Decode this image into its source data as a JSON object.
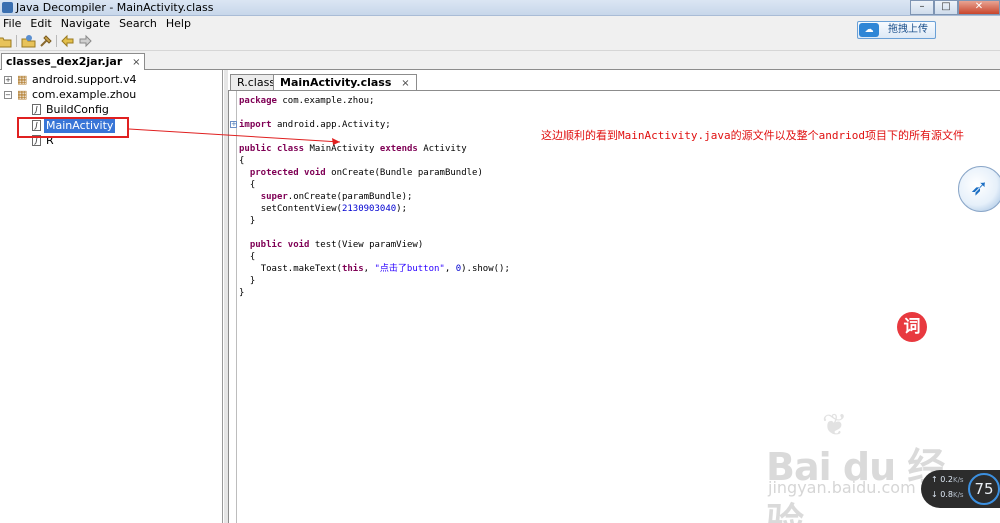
{
  "window": {
    "title": "Java Decompiler - MainActivity.class"
  },
  "menu": [
    "File",
    "Edit",
    "Navigate",
    "Search",
    "Help"
  ],
  "upload_button": "拖拽上传",
  "file_tab": {
    "label": "classes_dex2jar.jar",
    "close": "×"
  },
  "tree": {
    "items": [
      {
        "label": "android.support.v4",
        "expander": "+"
      },
      {
        "label": "com.example.zhou",
        "expander": "−"
      },
      {
        "label": "BuildConfig"
      },
      {
        "label": "MainActivity"
      },
      {
        "label": "R"
      }
    ]
  },
  "editor_tabs": [
    {
      "label": "R.class"
    },
    {
      "label": "MainActivity.class",
      "close": "×"
    }
  ],
  "code": {
    "l1": "com.example.zhou;",
    "l2": "android.app.Activity;",
    "l3_class": "MainActivity",
    "l3_super": "Activity",
    "l4": "{",
    "l5_sig": "onCreate(Bundle paramBundle)",
    "l6": "{",
    "l7": ".onCreate(paramBundle);",
    "l8_pre": "setContentView(",
    "l8_num": "2130903040",
    "l8_post": ");",
    "l9": "}",
    "l10_sig": "test(View paramView)",
    "l11": "{",
    "l12_pre": "Toast.makeText(",
    "l12_str": "\"点击了button\"",
    "l12_mid": ", ",
    "l12_num": "0",
    "l12_post": ").show();",
    "l13": "}",
    "l14": "}"
  },
  "annotation": "这边顺利的看到MainActivity.java的源文件以及整个andriod项目下的所有源文件",
  "float_button": "词",
  "watermark": {
    "brand": "Bai du 经验",
    "url": "jingyan.baidu.com"
  },
  "net": {
    "up": "0.2",
    "down": "0.8",
    "unit": "K/s",
    "percent": "75"
  },
  "colors": {
    "keyword": "#7f0055",
    "number": "#0000d0",
    "annotation": "#e01010",
    "selection": "#3875d7"
  }
}
